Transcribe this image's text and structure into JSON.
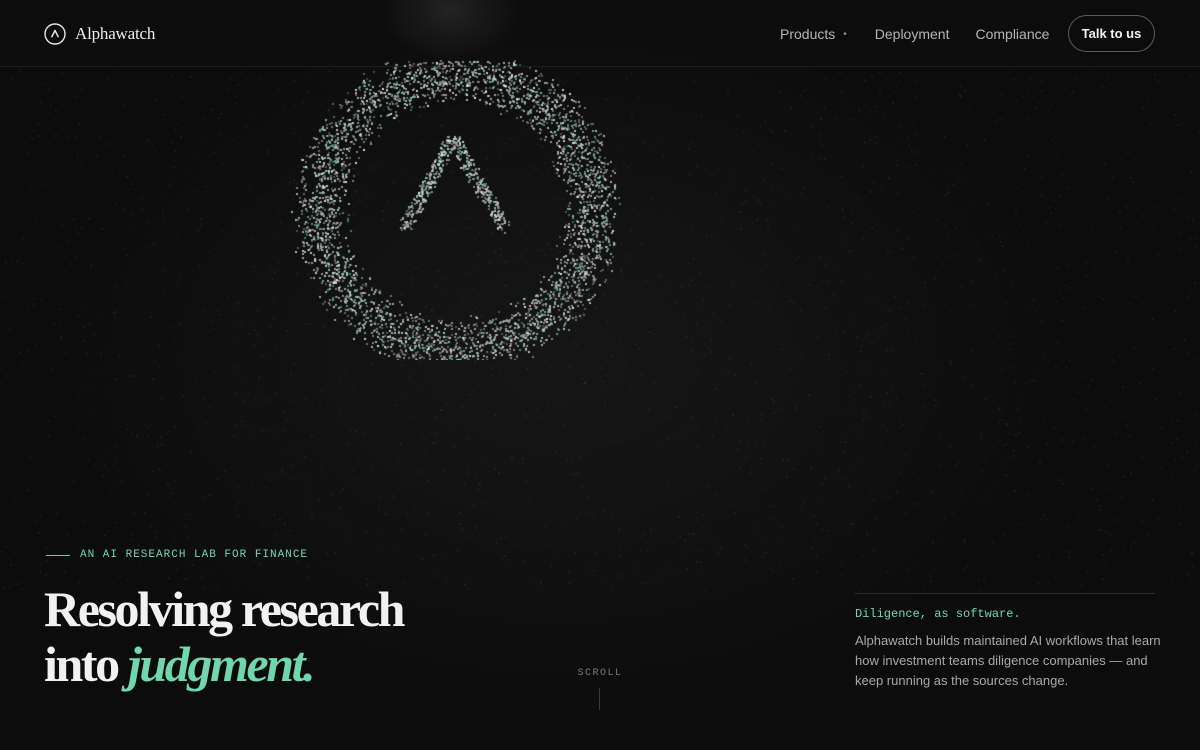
{
  "header": {
    "logo_text": "Alphawatch",
    "nav": {
      "products": "Products",
      "products_indicator": "•",
      "deployment": "Deployment",
      "compliance": "Compliance"
    },
    "cta_label": "Talk to us"
  },
  "hero": {
    "eyebrow": "AN AI RESEARCH LAB FOR FINANCE",
    "headline_line1": "Resolving research",
    "headline_line2_plain": "into",
    "headline_line2_accent": "judgment."
  },
  "scroll_label": "SCROLL",
  "side_panel": {
    "tagline": "Diligence, as software.",
    "description": "Alphawatch builds maintained AI workflows that learn how investment teams diligence companies — and keep running as the sources change."
  },
  "colors": {
    "background": "#0c0c0c",
    "accent": "#6fd6b0",
    "text_primary": "#f1f1f1",
    "text_muted": "#a8a8a8"
  },
  "icons": {
    "logo": "alphawatch-logo-icon",
    "particle_ring": "particle-ring-logo"
  }
}
